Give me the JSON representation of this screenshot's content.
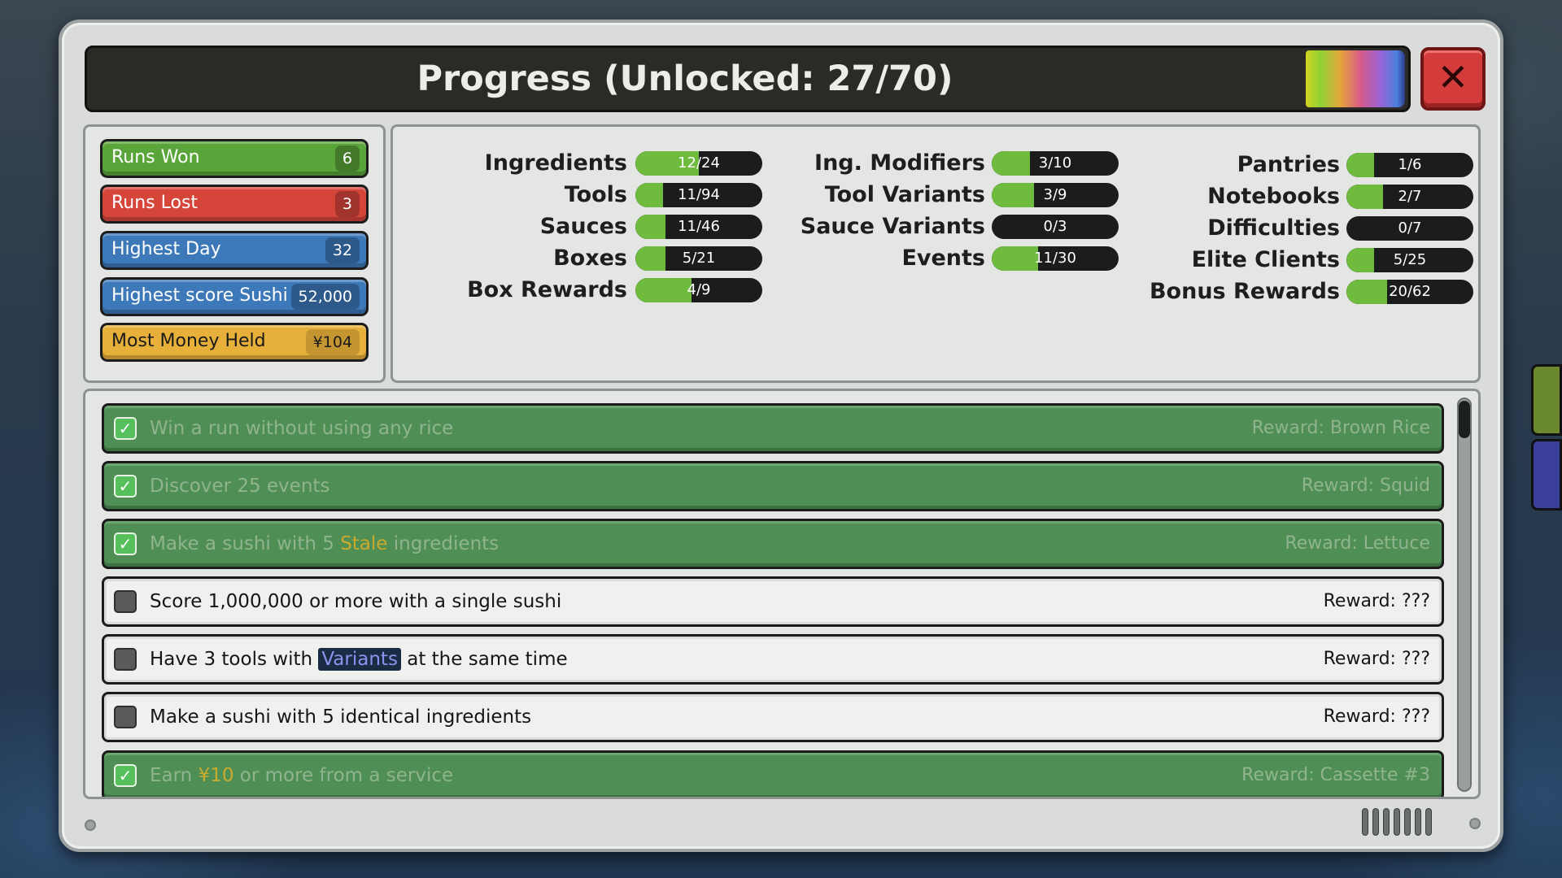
{
  "window": {
    "title": "Progress (Unlocked: 27/70)",
    "close_label": "✕"
  },
  "stats": [
    {
      "label": "Runs Won",
      "value": "6",
      "color": "#5aa53a"
    },
    {
      "label": "Runs Lost",
      "value": "3",
      "color": "#d6453a"
    },
    {
      "label": "Highest Day",
      "value": "32",
      "color": "#3d78b8"
    },
    {
      "label": "Highest score Sushi",
      "value": "52,000",
      "color": "#3d78b8"
    },
    {
      "label": "Most Money Held",
      "value": "¥104",
      "color": "#e7b03a"
    }
  ],
  "collection": {
    "col1": [
      {
        "label": "Ingredients",
        "value": "12/24",
        "fraction": 0.5
      },
      {
        "label": "Tools",
        "value": "11/94",
        "fraction": 0.117
      },
      {
        "label": "Sauces",
        "value": "11/46",
        "fraction": 0.239
      },
      {
        "label": "Boxes",
        "value": "5/21",
        "fraction": 0.238
      },
      {
        "label": "Box Rewards",
        "value": "4/9",
        "fraction": 0.444
      }
    ],
    "col2": [
      {
        "label": "Ing. Modifiers",
        "value": "3/10",
        "fraction": 0.3
      },
      {
        "label": "Tool Variants",
        "value": "3/9",
        "fraction": 0.333
      },
      {
        "label": "Sauce Variants",
        "value": "0/3",
        "fraction": 0
      },
      {
        "label": "Events",
        "value": "11/30",
        "fraction": 0.367
      }
    ],
    "col3": [
      {
        "label": "Pantries",
        "value": "1/6",
        "fraction": 0.167
      },
      {
        "label": "Notebooks",
        "value": "2/7",
        "fraction": 0.286
      },
      {
        "label": "Difficulties",
        "value": "0/7",
        "fraction": 0
      },
      {
        "label": "Elite Clients",
        "value": "5/25",
        "fraction": 0.2
      },
      {
        "label": "Bonus Rewards",
        "value": "20/62",
        "fraction": 0.323
      }
    ]
  },
  "achievements": [
    {
      "done": true,
      "parts": [
        "Win a run without using any rice"
      ],
      "reward": "Reward: Brown Rice"
    },
    {
      "done": true,
      "parts": [
        "Discover 25 events"
      ],
      "reward": "Reward: Squid"
    },
    {
      "done": true,
      "parts": [
        "Make a sushi with 5 ",
        "Stale",
        " ingredients"
      ],
      "reward": "Reward: Lettuce"
    },
    {
      "done": false,
      "parts": [
        "Score 1,000,000 or more with a single sushi"
      ],
      "reward": "Reward: ???"
    },
    {
      "done": false,
      "parts": [
        "Have 3 tools with ",
        "Variants",
        " at the same time"
      ],
      "reward": "Reward: ???"
    },
    {
      "done": false,
      "parts": [
        "Make a sushi with 5 identical ingredients"
      ],
      "reward": "Reward: ???"
    },
    {
      "done": true,
      "parts": [
        "Earn ",
        "¥10",
        " or more from a service"
      ],
      "reward": "Reward: Cassette #3"
    }
  ]
}
